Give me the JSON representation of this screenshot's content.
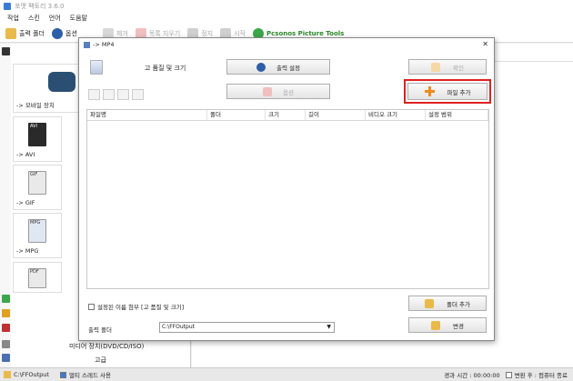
{
  "app": {
    "title": "포맷 팩토리 3.6.0",
    "menu": [
      "작업",
      "스킨",
      "언어",
      "도움말"
    ]
  },
  "toolbar": {
    "output_folder": "출력 폴더",
    "options": "옵션",
    "remove": "제거",
    "clear_list": "목록 지우기",
    "stop": "정지",
    "start": "시작",
    "picture_tools": "Pcsonos Picture Tools"
  },
  "left": {
    "mobile_label": "-> 모바일 장치",
    "formats": [
      "AVI",
      "GIF",
      "MPG",
      "PDF"
    ],
    "format_labels": [
      "-> AVI",
      "-> GIF",
      "-> MPG"
    ],
    "media_device": "미디어 장치(DVD/CD/ISO)",
    "advanced": "고급"
  },
  "dialog": {
    "title": "-> MP4",
    "quality_label": "고 품질 및 크기",
    "output_settings": "출력 설정",
    "options_btn": "옵션",
    "ok_btn": "확인",
    "add_file_btn": "파일 추가",
    "columns": [
      "파일명",
      "폴더",
      "크기",
      "길이",
      "비디오 크기",
      "설정 범위"
    ],
    "rename_checkbox": "설정된 이름 첨부 [고 품질 및 크기]",
    "add_folder_btn": "폴더 추가",
    "output_folder_label": "출력 폴더",
    "output_folder_value": "C:\\FFOutput",
    "change_btn": "변경"
  },
  "status": {
    "path": "C:\\FFOutput",
    "multithread": "멀티 스레드 사용",
    "elapsed": "경과 시간 : 00:00:00",
    "after_convert": "변환 후 : 컴퓨터 종료"
  },
  "colors": {
    "highlight": "#e02020",
    "add_icon": "#f08a1c"
  }
}
